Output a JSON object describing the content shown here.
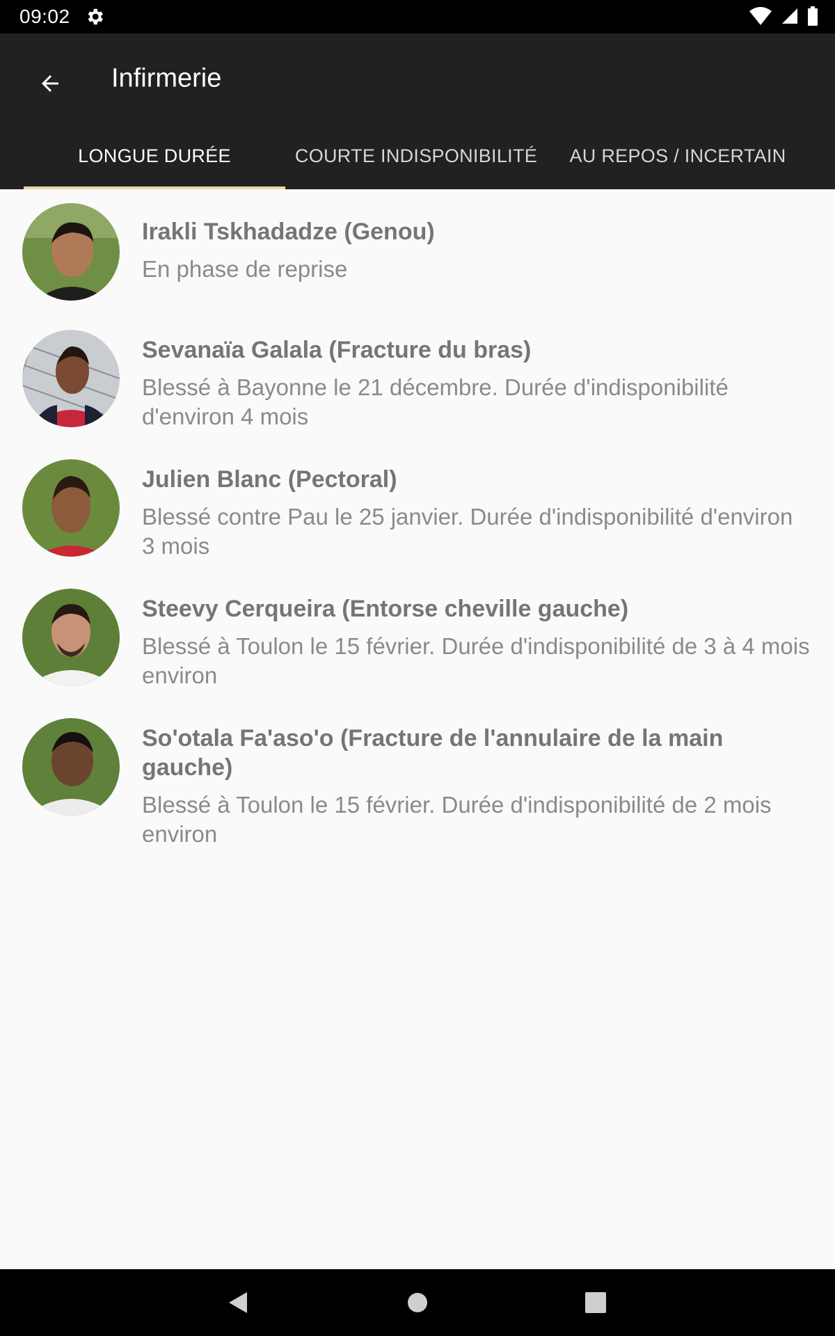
{
  "status_bar": {
    "time": "09:02"
  },
  "app_bar": {
    "title": "Infirmerie"
  },
  "tabs": [
    {
      "label": "LONGUE DURÉE",
      "active": true
    },
    {
      "label": "COURTE INDISPONIBILITÉ",
      "active": false
    },
    {
      "label": "AU REPOS / INCERTAIN",
      "active": false
    }
  ],
  "colors": {
    "app_bar_bg": "#212121",
    "tab_indicator": "#e9d6a6",
    "list_bg": "#fafafa",
    "text_primary": "#757575",
    "text_secondary": "#8a8a8a"
  },
  "players": [
    {
      "name": "Irakli Tskhadadze (Genou)",
      "status": "En phase de reprise",
      "jersey": "black",
      "skin": "#b07a58"
    },
    {
      "name": "Sevanaïa Galala (Fracture du bras)",
      "status": "Blessé à Bayonne le 21 décembre. Durée d'indisponibilité d'environ 4 mois",
      "jersey": "red",
      "skin": "#7a4a33"
    },
    {
      "name": "Julien Blanc (Pectoral)",
      "status": "Blessé contre Pau le 25 janvier. Durée d'indisponibilité d'environ 3 mois",
      "jersey": "red",
      "skin": "#8d5a3c"
    },
    {
      "name": "Steevy Cerqueira (Entorse cheville gauche)",
      "status": "Blessé à Toulon le 15 février. Durée d'indisponibilité de 3 à 4 mois environ",
      "jersey": "white",
      "skin": "#c89276"
    },
    {
      "name": "So'otala Fa'aso'o (Fracture de l'annulaire de la main gauche)",
      "status": "Blessé à Toulon le 15 février. Durée d'indisponibilité de 2 mois environ",
      "jersey": "white",
      "skin": "#6b4430"
    }
  ]
}
